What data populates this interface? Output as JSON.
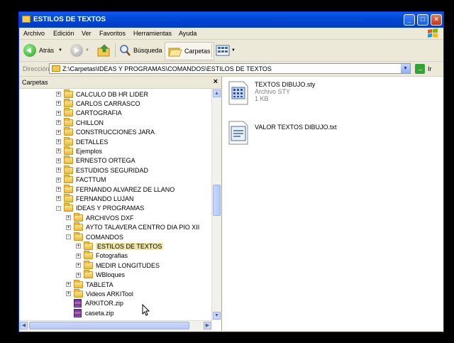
{
  "window": {
    "title": "ESTILOS DE TEXTOS"
  },
  "menu": [
    "Archivo",
    "Edición",
    "Ver",
    "Favoritos",
    "Herramientas",
    "Ayuda"
  ],
  "toolbar": {
    "back_label": "Atrás",
    "search_label": "Búsqueda",
    "folders_label": "Carpetas"
  },
  "address": {
    "label": "Dirección",
    "value": "Z:\\Carpetas\\IDEAS Y PROGRAMAS\\COMANDOS\\ESTILOS DE TEXTOS",
    "go_label": "Ir"
  },
  "folders_pane": {
    "title": "Carpetas",
    "close": "×",
    "items": [
      {
        "label": "CALCULO DB HR LIDER",
        "level": 0,
        "expander": "+",
        "type": "folder"
      },
      {
        "label": "CARLOS CARRASCO",
        "level": 0,
        "expander": "+",
        "type": "folder"
      },
      {
        "label": "CARTOGRAFIA",
        "level": 0,
        "expander": "+",
        "type": "folder"
      },
      {
        "label": "CHILLON",
        "level": 0,
        "expander": "+",
        "type": "folder"
      },
      {
        "label": "CONSTRUCCIONES JARA",
        "level": 0,
        "expander": "+",
        "type": "folder"
      },
      {
        "label": "DETALLES",
        "level": 0,
        "expander": "+",
        "type": "folder"
      },
      {
        "label": "Ejemplos",
        "level": 0,
        "expander": "+",
        "type": "folder"
      },
      {
        "label": "ERNESTO ORTEGA",
        "level": 0,
        "expander": "+",
        "type": "folder"
      },
      {
        "label": "ESTUDIOS SEGURIDAD",
        "level": 0,
        "expander": "+",
        "type": "folder"
      },
      {
        "label": "FACTTUM",
        "level": 0,
        "expander": "+",
        "type": "folder"
      },
      {
        "label": "FERNANDO ALVAREZ DE LLANO",
        "level": 0,
        "expander": "+",
        "type": "folder"
      },
      {
        "label": "FERNANDO LUJAN",
        "level": 0,
        "expander": "+",
        "type": "folder"
      },
      {
        "label": "IDEAS Y PROGRAMAS",
        "level": 0,
        "expander": "-",
        "type": "folder"
      },
      {
        "label": "ARCHIVOS DXF",
        "level": 1,
        "expander": "+",
        "type": "folder"
      },
      {
        "label": "AYTO TALAVERA CENTRO DIA PIO XII",
        "level": 1,
        "expander": "+",
        "type": "folder"
      },
      {
        "label": "COMANDOS",
        "level": 1,
        "expander": "-",
        "type": "folder"
      },
      {
        "label": "ESTILOS DE TEXTOS",
        "level": 2,
        "expander": "+",
        "type": "folder",
        "selected": true
      },
      {
        "label": "Fotografias",
        "level": 2,
        "expander": "+",
        "type": "folder"
      },
      {
        "label": "MEDIR LONGITUDES",
        "level": 2,
        "expander": "+",
        "type": "folder"
      },
      {
        "label": "WBloques",
        "level": 2,
        "expander": "+",
        "type": "folder"
      },
      {
        "label": "TABLETA",
        "level": 1,
        "expander": "+",
        "type": "folder"
      },
      {
        "label": "Videos ARKITool",
        "level": 1,
        "expander": "+",
        "type": "folder"
      },
      {
        "label": "ARKITOR.zip",
        "level": 1,
        "expander": "",
        "type": "zip"
      },
      {
        "label": "caseta.zip",
        "level": 1,
        "expander": "",
        "type": "zip"
      }
    ]
  },
  "files": [
    {
      "name": "TEXTOS DIBUJO.sty",
      "type": "Archivo STY",
      "size": "1 KB",
      "icon": "sty-file-icon"
    },
    {
      "name": "VALOR TEXTOS DIBUJO.txt",
      "icon": "txt-file-icon"
    }
  ]
}
